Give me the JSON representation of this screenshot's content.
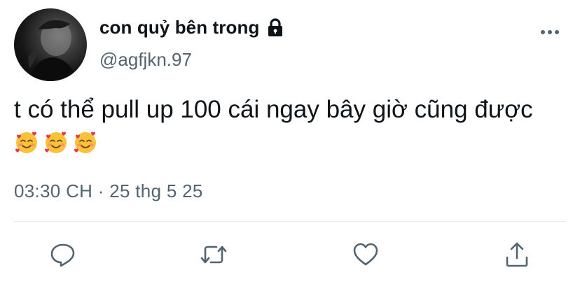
{
  "user": {
    "display_name": "con quỷ bên trong",
    "handle": "@agfjkn.97",
    "protected_icon": "lock-icon",
    "avatar": "avatar-photo"
  },
  "tweet": {
    "text": "t có thể pull up 100 cái ngay bây giờ cũng được",
    "emojis": [
      "smiling-face-with-hearts",
      "smiling-face-with-hearts",
      "smiling-face-with-hearts"
    ],
    "timestamp": "03:30 CH · 25 thg 5 25"
  },
  "actions": {
    "more": "more-icon",
    "reply": "reply-icon",
    "retweet": "retweet-icon",
    "like": "heart-icon",
    "share": "share-icon"
  },
  "colors": {
    "text_primary": "#0f1419",
    "text_secondary": "#536471",
    "divider": "#e7e9ea",
    "icon": "#536471"
  }
}
